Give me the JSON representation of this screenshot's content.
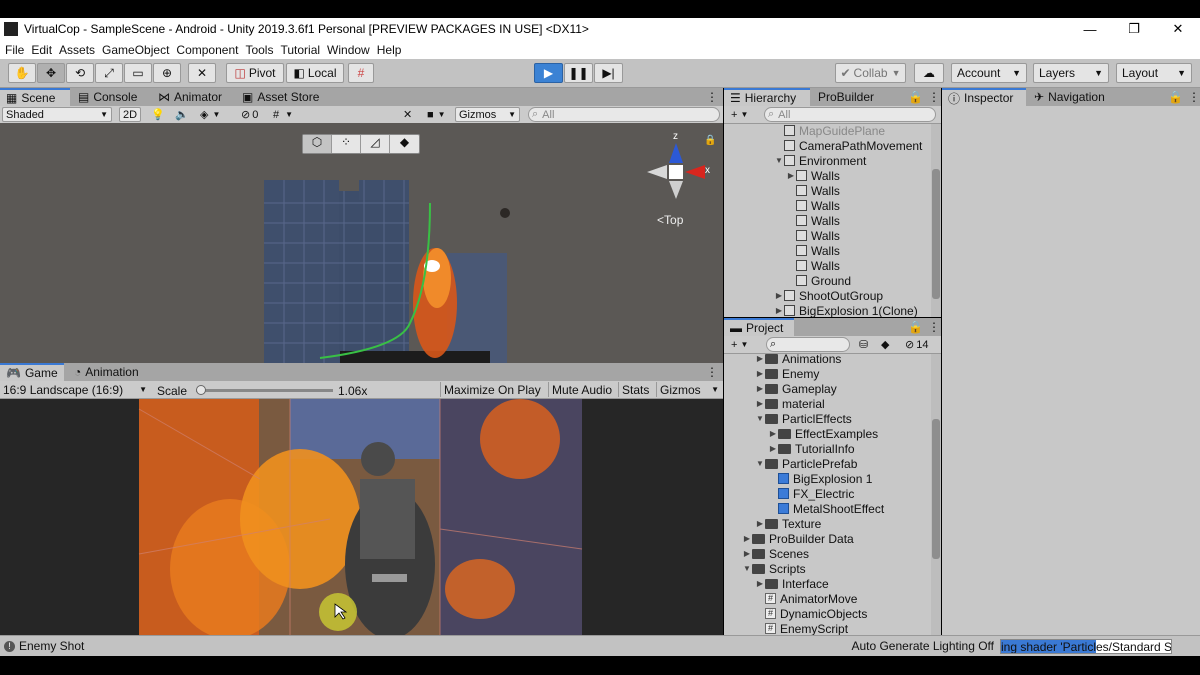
{
  "window": {
    "title": "VirtualCop - SampleScene - Android - Unity 2019.3.6f1 Personal [PREVIEW PACKAGES IN USE] <DX11>",
    "minimize": "—",
    "restore": "❐",
    "close": "✕"
  },
  "menu": [
    "File",
    "Edit",
    "Assets",
    "GameObject",
    "Component",
    "Tools",
    "Tutorial",
    "Window",
    "Help"
  ],
  "toolbar": {
    "pivot": "Pivot",
    "local": "Local",
    "collab": "Collab",
    "account": "Account",
    "layers": "Layers",
    "layout": "Layout"
  },
  "scene_tabs": [
    "Scene",
    "Console",
    "Animator",
    "Asset Store"
  ],
  "scene_bar": {
    "shading": "Shaded",
    "mode_2d": "2D",
    "hidden_count": "0",
    "gizmos": "Gizmos",
    "search_placeholder": "All",
    "axis_z": "z",
    "axis_x": "x",
    "view_label": "Top"
  },
  "game_tabs": [
    "Game",
    "Animation"
  ],
  "game_bar": {
    "aspect": "16:9 Landscape (16:9)",
    "scale_label": "Scale",
    "scale_value": "1.06x",
    "maximize": "Maximize On Play",
    "mute": "Mute Audio",
    "stats": "Stats",
    "gizmos": "Gizmos"
  },
  "hierarchy": {
    "tabs": [
      "Hierarchy",
      "ProBuilder"
    ],
    "search_placeholder": "All",
    "items": [
      {
        "label": "MapGuidePlane",
        "indent": 0,
        "arrow": "",
        "faded": true
      },
      {
        "label": "CameraPathMovement",
        "indent": 0,
        "arrow": ""
      },
      {
        "label": "Environment",
        "indent": 0,
        "arrow": "▼"
      },
      {
        "label": "Walls",
        "indent": 1,
        "arrow": "▶"
      },
      {
        "label": "Walls",
        "indent": 1,
        "arrow": ""
      },
      {
        "label": "Walls",
        "indent": 1,
        "arrow": ""
      },
      {
        "label": "Walls",
        "indent": 1,
        "arrow": ""
      },
      {
        "label": "Walls",
        "indent": 1,
        "arrow": ""
      },
      {
        "label": "Walls",
        "indent": 1,
        "arrow": ""
      },
      {
        "label": "Walls",
        "indent": 1,
        "arrow": ""
      },
      {
        "label": "Ground",
        "indent": 1,
        "arrow": ""
      },
      {
        "label": "ShootOutGroup",
        "indent": 0,
        "arrow": "▶"
      },
      {
        "label": "BigExplosion 1(Clone)",
        "indent": 0,
        "arrow": "▶"
      }
    ]
  },
  "project": {
    "tab": "Project",
    "count": "14",
    "items": [
      {
        "label": "Animations",
        "indent": 1,
        "arrow": "▶",
        "kind": "folder"
      },
      {
        "label": "Enemy",
        "indent": 1,
        "arrow": "▶",
        "kind": "folder"
      },
      {
        "label": "Gameplay",
        "indent": 1,
        "arrow": "▶",
        "kind": "folder"
      },
      {
        "label": "material",
        "indent": 1,
        "arrow": "▶",
        "kind": "folder"
      },
      {
        "label": "ParticlEffects",
        "indent": 1,
        "arrow": "▼",
        "kind": "folder"
      },
      {
        "label": "EffectExamples",
        "indent": 2,
        "arrow": "▶",
        "kind": "folder"
      },
      {
        "label": "TutorialInfo",
        "indent": 2,
        "arrow": "▶",
        "kind": "folder"
      },
      {
        "label": "ParticlePrefab",
        "indent": 1,
        "arrow": "▼",
        "kind": "folder"
      },
      {
        "label": "BigExplosion 1",
        "indent": 2,
        "arrow": "",
        "kind": "prefab"
      },
      {
        "label": "FX_Electric",
        "indent": 2,
        "arrow": "",
        "kind": "prefab"
      },
      {
        "label": "MetalShootEffect",
        "indent": 2,
        "arrow": "",
        "kind": "prefab"
      },
      {
        "label": "Texture",
        "indent": 1,
        "arrow": "▶",
        "kind": "folder"
      },
      {
        "label": "ProBuilder Data",
        "indent": 0,
        "arrow": "▶",
        "kind": "folder"
      },
      {
        "label": "Scenes",
        "indent": 0,
        "arrow": "▶",
        "kind": "folder"
      },
      {
        "label": "Scripts",
        "indent": 0,
        "arrow": "▼",
        "kind": "folder"
      },
      {
        "label": "Interface",
        "indent": 1,
        "arrow": "▶",
        "kind": "folder"
      },
      {
        "label": "AnimatorMove",
        "indent": 1,
        "arrow": "",
        "kind": "script"
      },
      {
        "label": "DynamicObjects",
        "indent": 1,
        "arrow": "",
        "kind": "script"
      },
      {
        "label": "EnemyScript",
        "indent": 1,
        "arrow": "",
        "kind": "script"
      }
    ]
  },
  "inspector_tabs": [
    "Inspector",
    "Navigation"
  ],
  "status": {
    "message": "Enemy Shot",
    "lighting": "Auto Generate Lighting Off",
    "progress": "ing shader 'Particles/Standard S"
  },
  "colors": {
    "accent": "#3a79d4",
    "play": "#3b82d4",
    "prefab": "#3b7bd8"
  }
}
